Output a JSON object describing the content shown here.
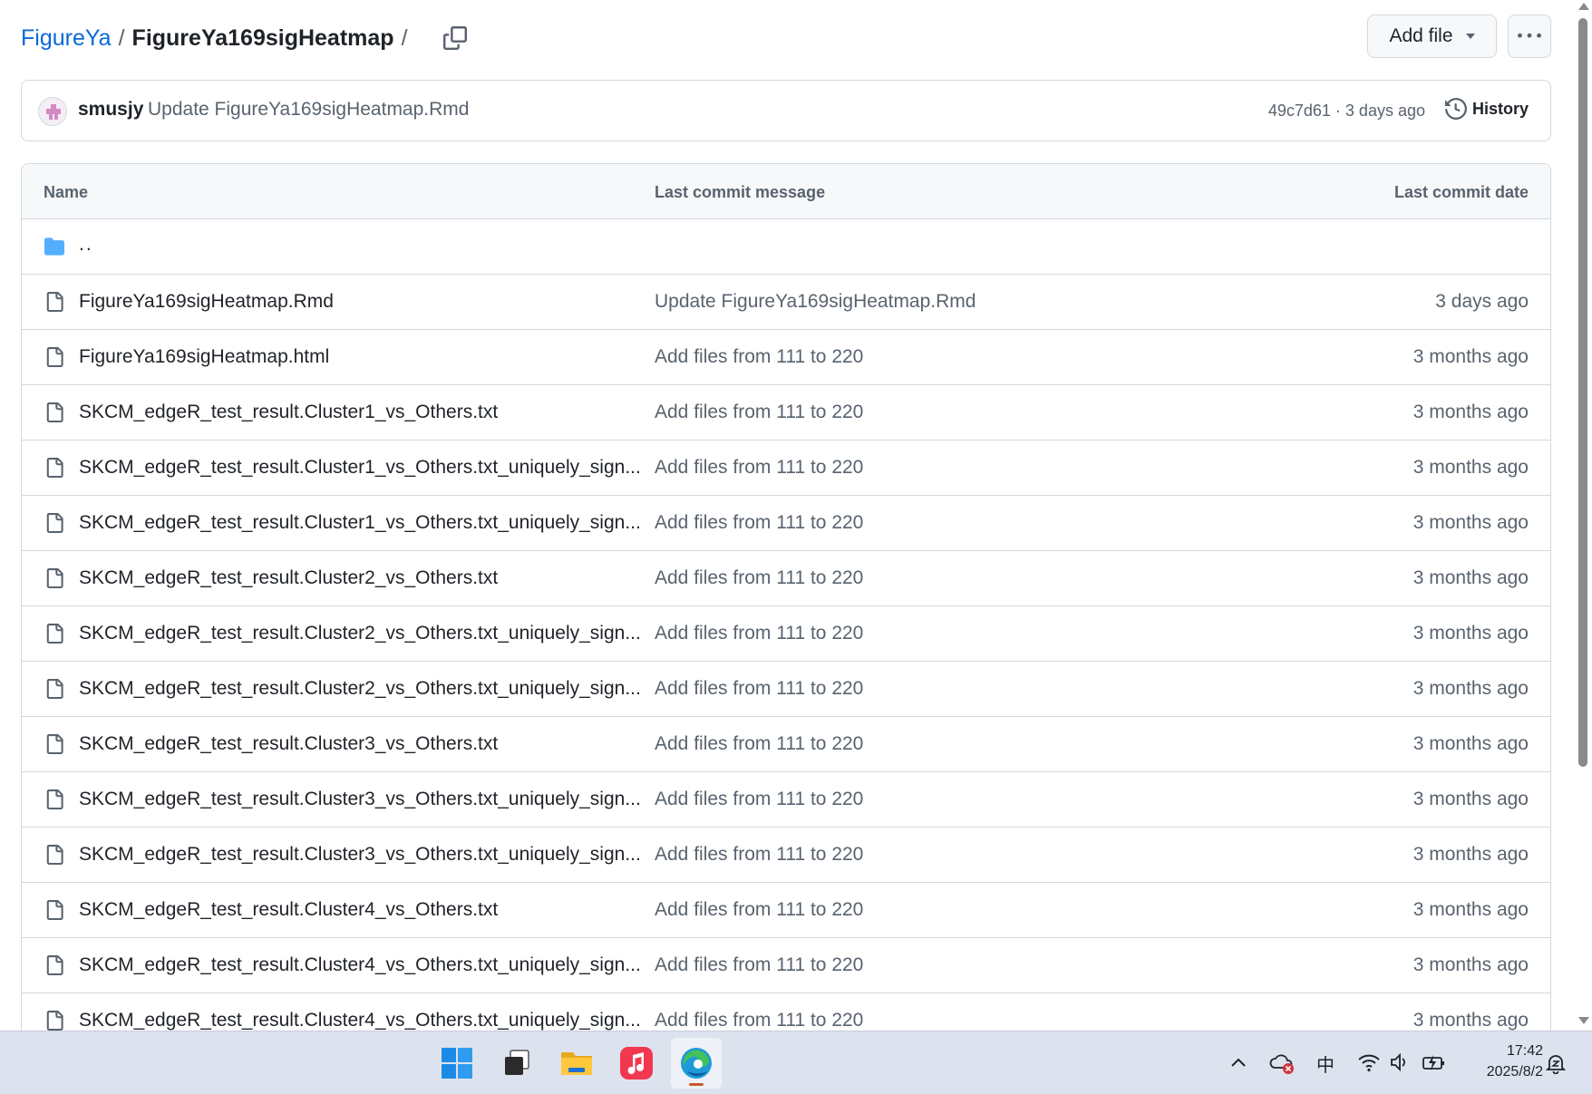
{
  "breadcrumb": {
    "repo": "FigureYa",
    "separator": "/",
    "folder": "FigureYa169sigHeatmap",
    "trailing_separator": "/"
  },
  "actions": {
    "add_file_label": "Add file",
    "more_icon": "kebab-horizontal-icon",
    "copy_icon": "copy-icon"
  },
  "latest_commit": {
    "author": "smusjy",
    "message": "Update FigureYa169sigHeatmap.Rmd",
    "sha": "49c7d61",
    "dot": "·",
    "time": "3 days ago",
    "history_label": "History"
  },
  "table": {
    "headers": {
      "name": "Name",
      "message": "Last commit message",
      "date": "Last commit date"
    },
    "parent": {
      "name": "..",
      "icon": "folder-icon"
    },
    "rows": [
      {
        "name": "FigureYa169sigHeatmap.Rmd",
        "message": "Update FigureYa169sigHeatmap.Rmd",
        "date": "3 days ago"
      },
      {
        "name": "FigureYa169sigHeatmap.html",
        "message": "Add files from 111 to 220",
        "date": "3 months ago"
      },
      {
        "name": "SKCM_edgeR_test_result.Cluster1_vs_Others.txt",
        "message": "Add files from 111 to 220",
        "date": "3 months ago"
      },
      {
        "name": "SKCM_edgeR_test_result.Cluster1_vs_Others.txt_uniquely_sign...",
        "message": "Add files from 111 to 220",
        "date": "3 months ago"
      },
      {
        "name": "SKCM_edgeR_test_result.Cluster1_vs_Others.txt_uniquely_sign...",
        "message": "Add files from 111 to 220",
        "date": "3 months ago"
      },
      {
        "name": "SKCM_edgeR_test_result.Cluster2_vs_Others.txt",
        "message": "Add files from 111 to 220",
        "date": "3 months ago"
      },
      {
        "name": "SKCM_edgeR_test_result.Cluster2_vs_Others.txt_uniquely_sign...",
        "message": "Add files from 111 to 220",
        "date": "3 months ago"
      },
      {
        "name": "SKCM_edgeR_test_result.Cluster2_vs_Others.txt_uniquely_sign...",
        "message": "Add files from 111 to 220",
        "date": "3 months ago"
      },
      {
        "name": "SKCM_edgeR_test_result.Cluster3_vs_Others.txt",
        "message": "Add files from 111 to 220",
        "date": "3 months ago"
      },
      {
        "name": "SKCM_edgeR_test_result.Cluster3_vs_Others.txt_uniquely_sign...",
        "message": "Add files from 111 to 220",
        "date": "3 months ago"
      },
      {
        "name": "SKCM_edgeR_test_result.Cluster3_vs_Others.txt_uniquely_sign...",
        "message": "Add files from 111 to 220",
        "date": "3 months ago"
      },
      {
        "name": "SKCM_edgeR_test_result.Cluster4_vs_Others.txt",
        "message": "Add files from 111 to 220",
        "date": "3 months ago"
      },
      {
        "name": "SKCM_edgeR_test_result.Cluster4_vs_Others.txt_uniquely_sign...",
        "message": "Add files from 111 to 220",
        "date": "3 months ago"
      },
      {
        "name": "SKCM_edgeR_test_result.Cluster4_vs_Others.txt_uniquely_sign...",
        "message": "Add files from 111 to 220",
        "date": "3 months ago"
      }
    ]
  },
  "taskbar": {
    "apps": [
      {
        "name": "start-icon"
      },
      {
        "name": "task-view-icon"
      },
      {
        "name": "file-explorer-icon"
      },
      {
        "name": "music-app-icon"
      },
      {
        "name": "edge-browser-icon",
        "active": true
      }
    ],
    "tray": {
      "chevron_icon": "chevron-up-icon",
      "onedrive_icon": "cloud-error-icon",
      "ime_label": "中",
      "wifi_icon": "wifi-icon",
      "volume_icon": "volume-icon",
      "battery_icon": "battery-charging-icon",
      "notification_icon": "notification-icon"
    },
    "clock": {
      "time": "17:42",
      "date": "2025/8/2"
    }
  },
  "colors": {
    "link": "#0969da",
    "muted": "#59636e",
    "border": "#d1d9e0",
    "folder": "#54aeff"
  }
}
